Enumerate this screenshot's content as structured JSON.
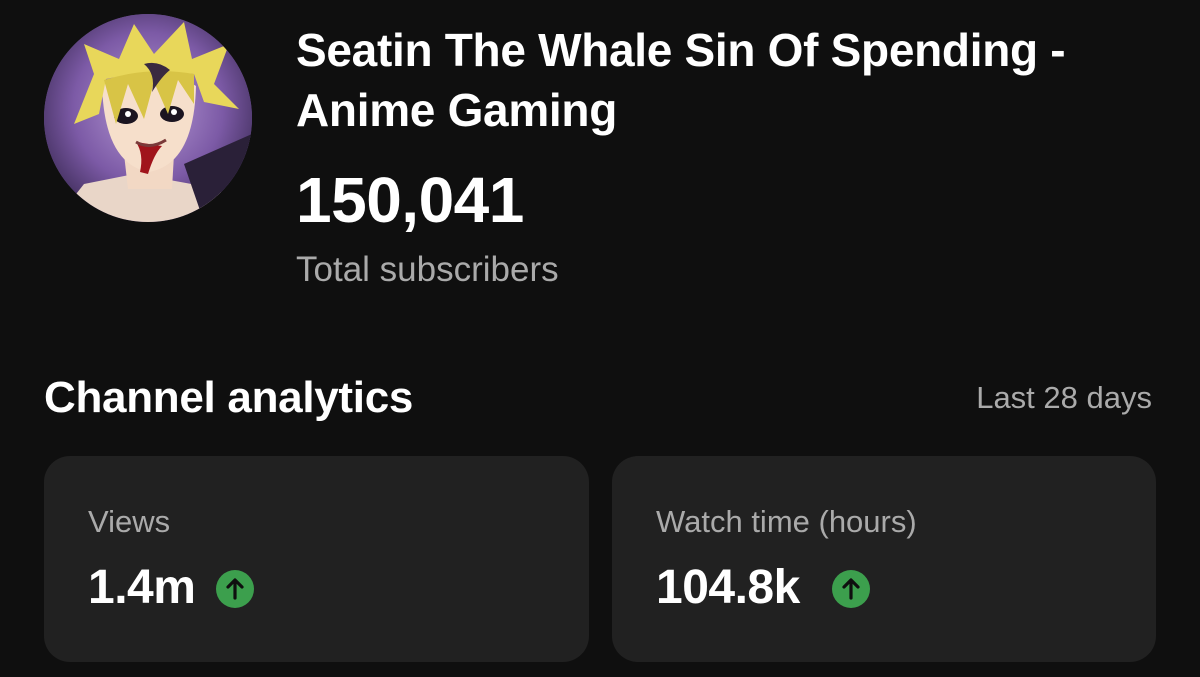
{
  "channel": {
    "title": "Seatin The Whale Sin Of Spending - Anime Gaming",
    "subscriber_count": "150,041",
    "subscriber_label": "Total subscribers",
    "avatar_icon": "channel-avatar-anime-character"
  },
  "analytics": {
    "title": "Channel analytics",
    "range": "Last 28 days",
    "cards": [
      {
        "label": "Views",
        "value": "1.4m",
        "trend": "up",
        "trend_icon": "arrow-up-icon",
        "trend_color": "#3c9f4d"
      },
      {
        "label": "Watch time (hours)",
        "value": "104.8k",
        "trend": "up",
        "trend_icon": "arrow-up-icon",
        "trend_color": "#3c9f4d"
      }
    ]
  },
  "colors": {
    "background": "#0f0f0f",
    "card": "#212121",
    "secondary_text": "#aaaaaa",
    "positive": "#3c9f4d"
  }
}
